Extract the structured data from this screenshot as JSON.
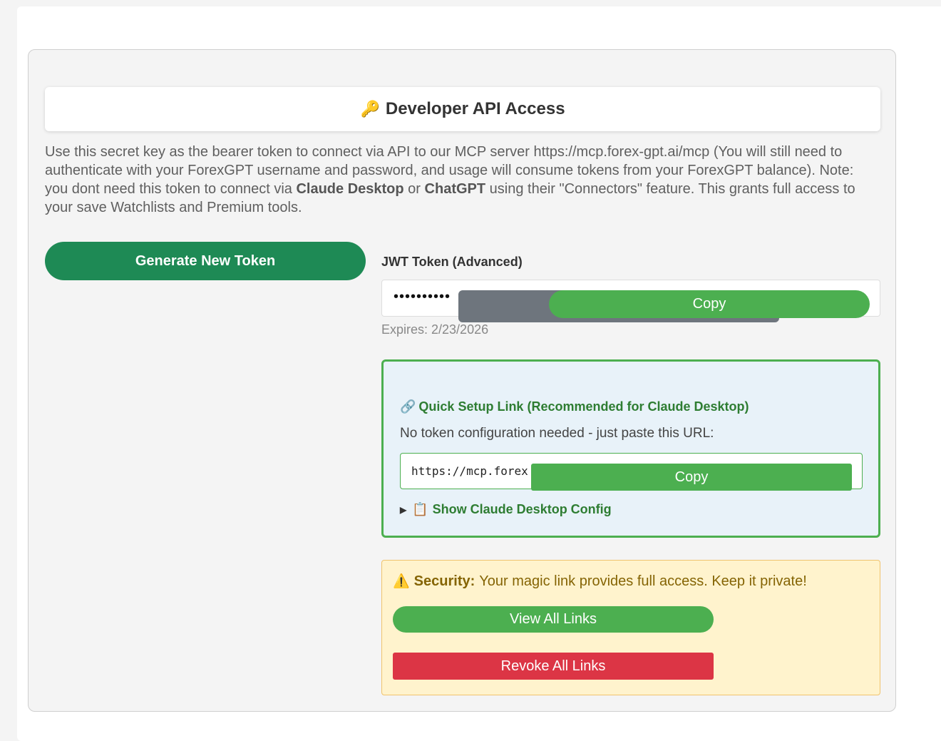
{
  "header": {
    "title": "Developer API Access",
    "icon": "key-icon"
  },
  "intro": {
    "text_1": "Use this secret key as the bearer token to connect via API to our MCP server https://mcp.forex-gpt.ai/mcp (You will still need to authenticate with your ForexGPT username and password, and usage will consume tokens from your ForexGPT balance). Note: you dont need this token to connect via ",
    "bold_1": "Claude Desktop",
    "text_2": " or ",
    "bold_2": "ChatGPT",
    "text_3": " using their \"Connectors\" feature. This grants full access to your save Watchlists and Premium tools."
  },
  "actions": {
    "generate_label": "Generate New Token"
  },
  "jwt": {
    "label": "JWT Token (Advanced)",
    "masked_value": "••••••••••",
    "copy_label": "Copy",
    "expires": "Expires: 2/23/2026"
  },
  "quick_setup": {
    "title": "Quick Setup Link (Recommended for Claude Desktop)",
    "subtitle": "No token configuration needed - just paste this URL:",
    "url": "https://mcp.forex",
    "copy_label": "Copy",
    "config_toggle": "Show Claude Desktop Config"
  },
  "security": {
    "label": "Security:",
    "message": "Your magic link provides full access. Keep it private!",
    "view_label": "View All Links",
    "revoke_label": "Revoke All Links"
  },
  "colors": {
    "primary_green": "#1e8a55",
    "accent_green": "#4caf50",
    "danger_red": "#dc3545",
    "warning_bg": "#fff3cd",
    "info_bg": "#e8f2f9"
  }
}
